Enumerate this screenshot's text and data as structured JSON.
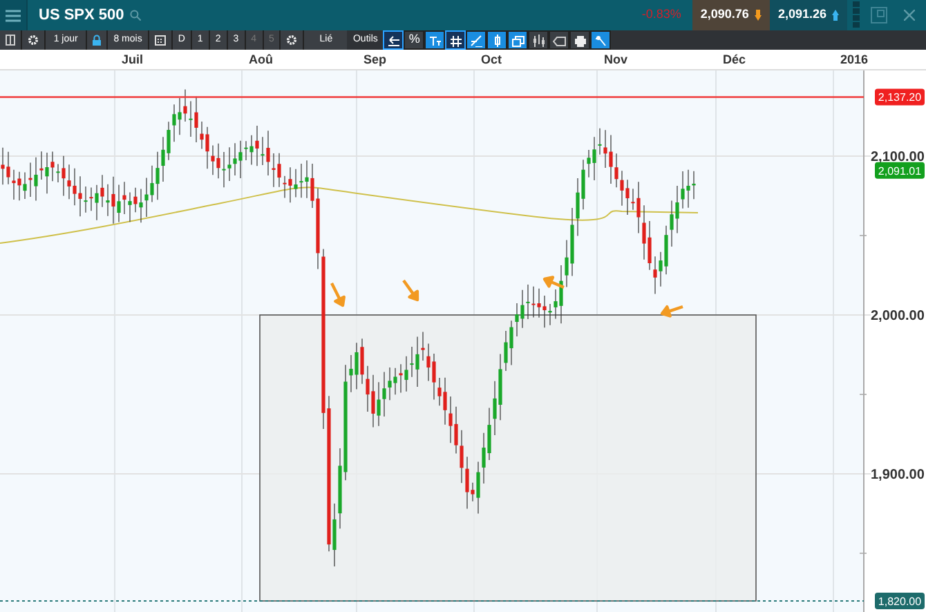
{
  "window": {
    "title": "US SPX 500"
  },
  "quote": {
    "change": "-0.83%",
    "sell": "2,090.76",
    "buy": "2,091.26"
  },
  "toolbar": {
    "interval": "1 jour",
    "period": "8 mois",
    "layout_buttons": [
      {
        "label": "D",
        "disabled": false
      },
      {
        "label": "1",
        "disabled": false
      },
      {
        "label": "2",
        "disabled": false
      },
      {
        "label": "3",
        "disabled": false
      },
      {
        "label": "4",
        "disabled": true
      },
      {
        "label": "5",
        "disabled": true
      }
    ],
    "link_button": "Lié",
    "tools_label": "Outils",
    "tool_buttons": [
      {
        "kind": "back",
        "active": false,
        "selected": true
      },
      {
        "kind": "percent",
        "label": "%",
        "active": false,
        "selected": false
      },
      {
        "kind": "text",
        "active": true,
        "selected": false
      },
      {
        "kind": "grid",
        "active": false,
        "selected": true
      },
      {
        "kind": "draw",
        "active": true,
        "selected": false
      },
      {
        "kind": "candle",
        "active": true,
        "selected": false
      },
      {
        "kind": "windows",
        "active": true,
        "selected": false
      },
      {
        "kind": "candles",
        "active": false,
        "selected": false
      },
      {
        "kind": "tag",
        "active": false,
        "selected": false
      },
      {
        "kind": "print",
        "active": false,
        "selected": false
      },
      {
        "kind": "settings",
        "active": true,
        "selected": false
      }
    ]
  },
  "chart": {
    "x_labels": [
      "Juil",
      "Aoû",
      "Sep",
      "Oct",
      "Nov",
      "Déc",
      "2016"
    ],
    "y_labels": [
      "2,100.00",
      "2,000.00",
      "1,900.00"
    ],
    "price_tags": [
      {
        "kind": "high",
        "text": "2,137.20"
      },
      {
        "kind": "last",
        "text": "2,091.01"
      },
      {
        "kind": "low",
        "text": "1,820.00"
      }
    ]
  }
}
